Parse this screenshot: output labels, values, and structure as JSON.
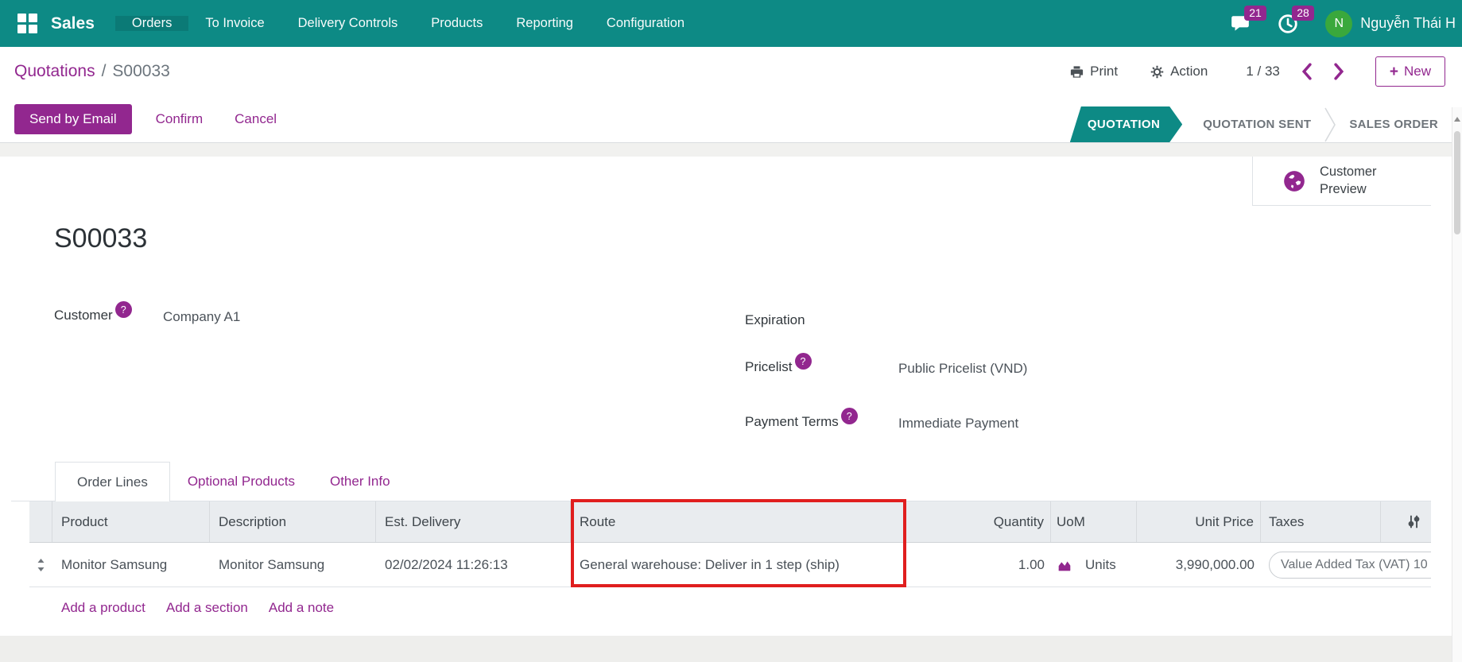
{
  "colors": {
    "accent": "#92278f",
    "teal": "#0d8a85",
    "nav_active": "#0b7a76",
    "highlight_red": "#e01e1e",
    "avatar_green": "#3aa83c"
  },
  "nav": {
    "app_name": "Sales",
    "items": [
      "Orders",
      "To Invoice",
      "Delivery Controls",
      "Products",
      "Reporting",
      "Configuration"
    ],
    "active_item": "Orders",
    "messages_badge": "21",
    "activities_badge": "28",
    "user_initial": "N",
    "user_name": "Nguyễn Thái H"
  },
  "breadcrumb": {
    "parent": "Quotations",
    "separator": "/",
    "current": "S00033"
  },
  "control_panel": {
    "print_label": "Print",
    "action_label": "Action",
    "pager": "1 / 33",
    "new_plus": "+",
    "new_label": "New"
  },
  "actions": {
    "send_by_email": "Send by Email",
    "confirm": "Confirm",
    "cancel": "Cancel"
  },
  "statusbar": {
    "stages": [
      "QUOTATION",
      "QUOTATION SENT",
      "SALES ORDER"
    ],
    "active": "QUOTATION"
  },
  "customer_preview": {
    "line1": "Customer",
    "line2": "Preview"
  },
  "form": {
    "title": "S00033",
    "help_glyph": "?",
    "fields": {
      "customer": {
        "label": "Customer",
        "value": "Company A1"
      },
      "expiration": {
        "label": "Expiration",
        "value": ""
      },
      "pricelist": {
        "label": "Pricelist",
        "value": "Public Pricelist (VND)"
      },
      "payment_terms": {
        "label": "Payment Terms",
        "value": "Immediate Payment"
      }
    }
  },
  "tabs": [
    {
      "label": "Order Lines",
      "active": true
    },
    {
      "label": "Optional Products",
      "active": false
    },
    {
      "label": "Other Info",
      "active": false
    }
  ],
  "order_lines": {
    "columns": [
      "Product",
      "Description",
      "Est. Delivery",
      "Route",
      "Quantity",
      "UoM",
      "Unit Price",
      "Taxes"
    ],
    "rows": [
      {
        "product": "Monitor Samsung",
        "description": "Monitor Samsung",
        "est_delivery": "02/02/2024 11:26:13",
        "route": "General warehouse: Deliver in 1 step (ship)",
        "quantity": "1.00",
        "uom": "Units",
        "unit_price": "3,990,000.00",
        "taxes": "Value Added Tax (VAT) 10"
      }
    ],
    "footer_links": [
      "Add a product",
      "Add a section",
      "Add a note"
    ]
  },
  "icons": {
    "apps": "grid",
    "messages": "speech-bubble",
    "activities": "clock",
    "print": "printer",
    "action": "gear",
    "pager_prev": "chevron-left",
    "pager_next": "chevron-right",
    "new": "plus",
    "help": "question-circle",
    "customer_preview": "globe",
    "row_drag": "up-down-arrows",
    "forecast": "area-chart",
    "optional_columns": "sliders"
  }
}
